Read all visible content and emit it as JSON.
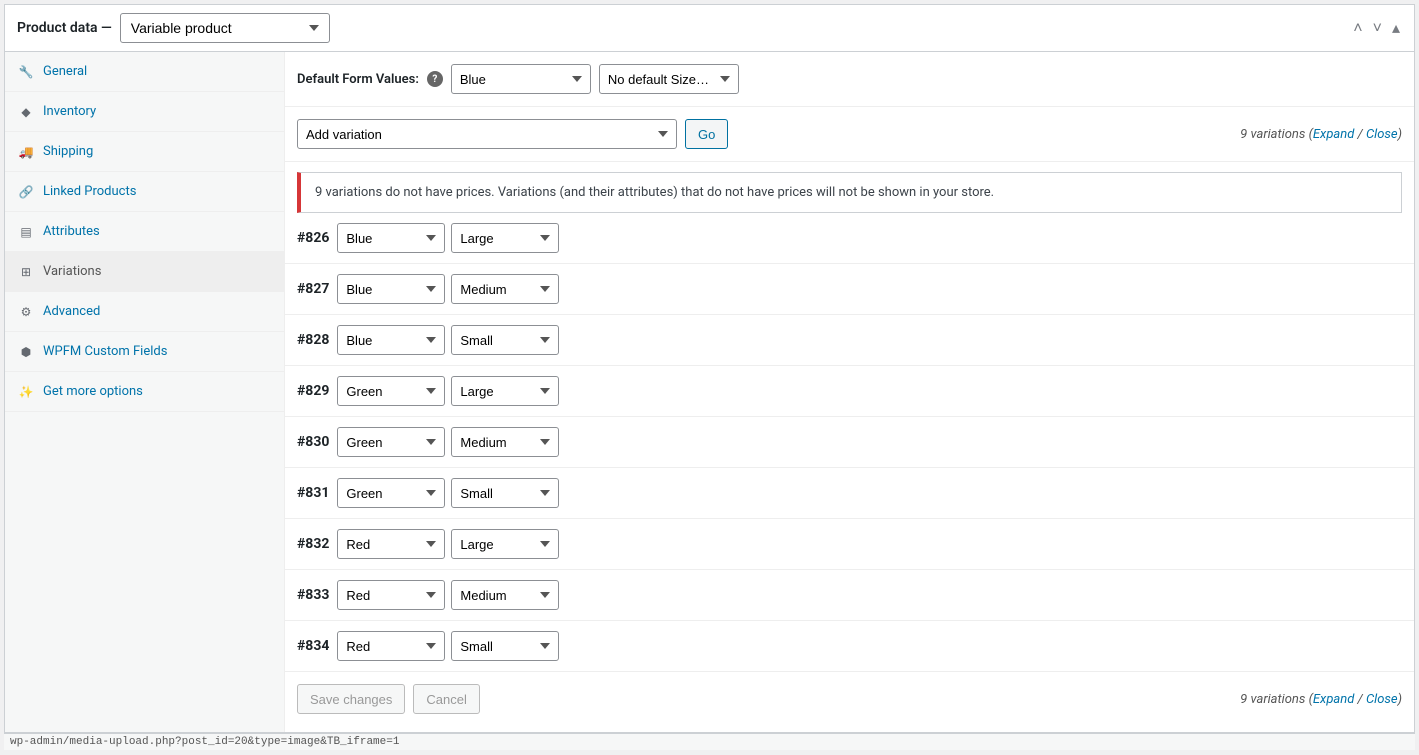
{
  "header": {
    "title": "Product data —",
    "product_type": "Variable product"
  },
  "tabs": [
    {
      "key": "general",
      "label": "General",
      "icon": "wrench"
    },
    {
      "key": "inventory",
      "label": "Inventory",
      "icon": "box"
    },
    {
      "key": "shipping",
      "label": "Shipping",
      "icon": "truck"
    },
    {
      "key": "linked",
      "label": "Linked Products",
      "icon": "link"
    },
    {
      "key": "attributes",
      "label": "Attributes",
      "icon": "list"
    },
    {
      "key": "variations",
      "label": "Variations",
      "icon": "grid",
      "active": true
    },
    {
      "key": "advanced",
      "label": "Advanced",
      "icon": "gear"
    },
    {
      "key": "wpfm",
      "label": "WPFM Custom Fields",
      "icon": "cube"
    },
    {
      "key": "more",
      "label": "Get more options",
      "icon": "wand"
    }
  ],
  "defaults": {
    "label": "Default Form Values:",
    "color": "Blue",
    "size": "No default Size…"
  },
  "actions": {
    "add_variation": "Add variation",
    "go": "Go",
    "count_text": "9 variations",
    "expand": "Expand",
    "close": "Close"
  },
  "notice": "9 variations do not have prices. Variations (and their attributes) that do not have prices will not be shown in your store.",
  "variations": [
    {
      "id": "#826",
      "color": "Blue",
      "size": "Large"
    },
    {
      "id": "#827",
      "color": "Blue",
      "size": "Medium"
    },
    {
      "id": "#828",
      "color": "Blue",
      "size": "Small"
    },
    {
      "id": "#829",
      "color": "Green",
      "size": "Large"
    },
    {
      "id": "#830",
      "color": "Green",
      "size": "Medium"
    },
    {
      "id": "#831",
      "color": "Green",
      "size": "Small"
    },
    {
      "id": "#832",
      "color": "Red",
      "size": "Large"
    },
    {
      "id": "#833",
      "color": "Red",
      "size": "Medium"
    },
    {
      "id": "#834",
      "color": "Red",
      "size": "Small"
    }
  ],
  "footer": {
    "save": "Save changes",
    "cancel": "Cancel"
  },
  "statusbar": "wp-admin/media-upload.php?post_id=20&type=image&TB_iframe=1"
}
